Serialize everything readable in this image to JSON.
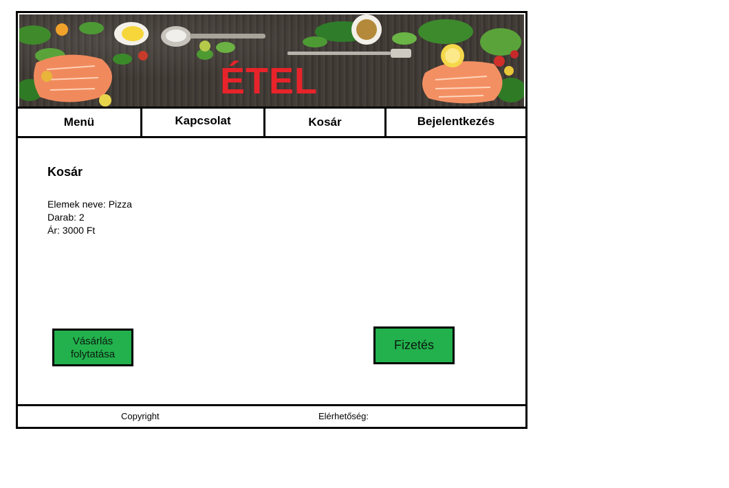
{
  "header": {
    "banner_title": "ÉTEL"
  },
  "nav": {
    "items": [
      {
        "label": "Menü"
      },
      {
        "label": "Kapcsolat"
      },
      {
        "label": "Kosár"
      },
      {
        "label": "Bejelentkezés"
      }
    ]
  },
  "cart": {
    "title": "Kosár",
    "item_name": "Elemek neve: Pizza",
    "quantity": "Darab: 2",
    "price": "Ár: 3000 Ft"
  },
  "actions": {
    "continue_line1": "Vásárlás",
    "continue_line2": "folytatása",
    "pay_label": "Fizetés",
    "button_color": "#22b14c"
  },
  "footer": {
    "copyright": "Copyright",
    "contact": "Elérhetőség:"
  },
  "colors": {
    "title_red": "#e8232a",
    "border": "#000000"
  }
}
